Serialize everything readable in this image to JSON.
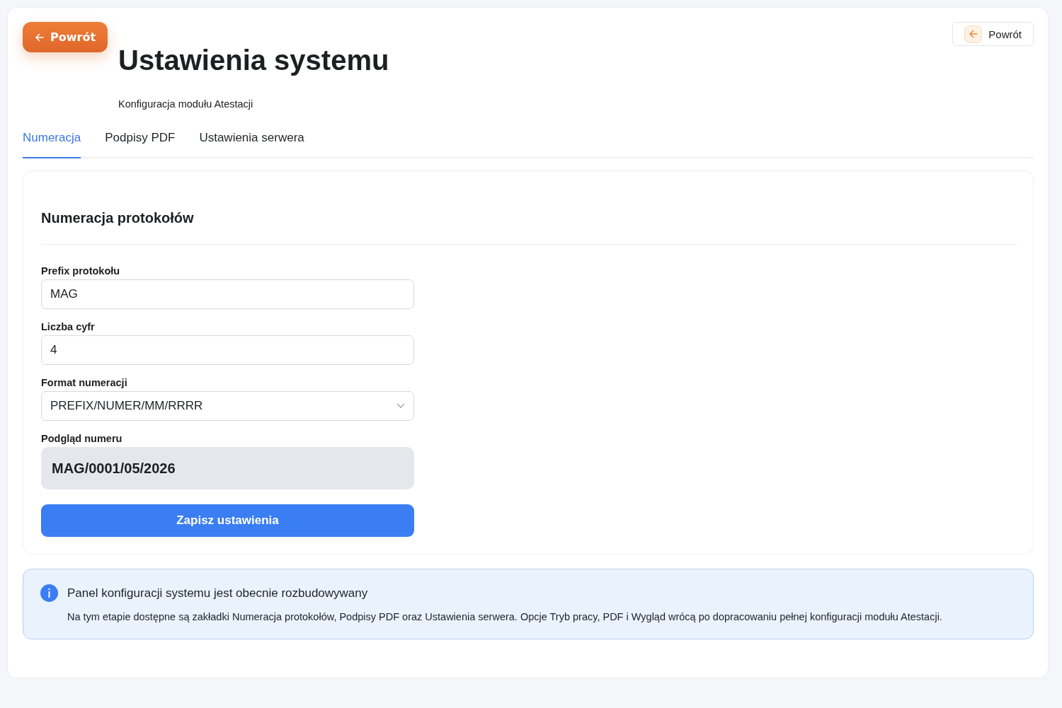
{
  "header": {
    "back_button": "Powrót",
    "title": "Ustawienia systemu",
    "subtitle": "Konfiguracja modułu Atestacji",
    "secondary_back_button": "Powrót"
  },
  "tabs": [
    {
      "label": "Numeracja",
      "selected": true
    },
    {
      "label": "Podpisy PDF",
      "selected": false
    },
    {
      "label": "Ustawienia serwera",
      "selected": false
    }
  ],
  "section": {
    "title": "Numeracja protokołów",
    "fields": [
      {
        "kind": "input",
        "label": "Prefix protokołu",
        "value": "MAG"
      },
      {
        "kind": "input",
        "label": "Liczba cyfr",
        "value": "4"
      },
      {
        "kind": "select",
        "label": "Format numeracji",
        "value": "PREFIX/NUMER/MM/RRRR"
      },
      {
        "kind": "preview",
        "label": "Podgląd numeru",
        "value": "MAG/0001/05/2026"
      }
    ],
    "save_button": "Zapisz ustawienia"
  },
  "info": {
    "title": "Panel konfiguracji systemu jest obecnie rozbudowywany",
    "text": "Na tym etapie dostępne są zakładki Numeracja protokołów, Podpisy PDF oraz Ustawienia serwera. Opcje Tryb pracy, PDF i Wygląd wrócą po dopracowaniu pełnej konfiguracji modułu Atestacji."
  }
}
